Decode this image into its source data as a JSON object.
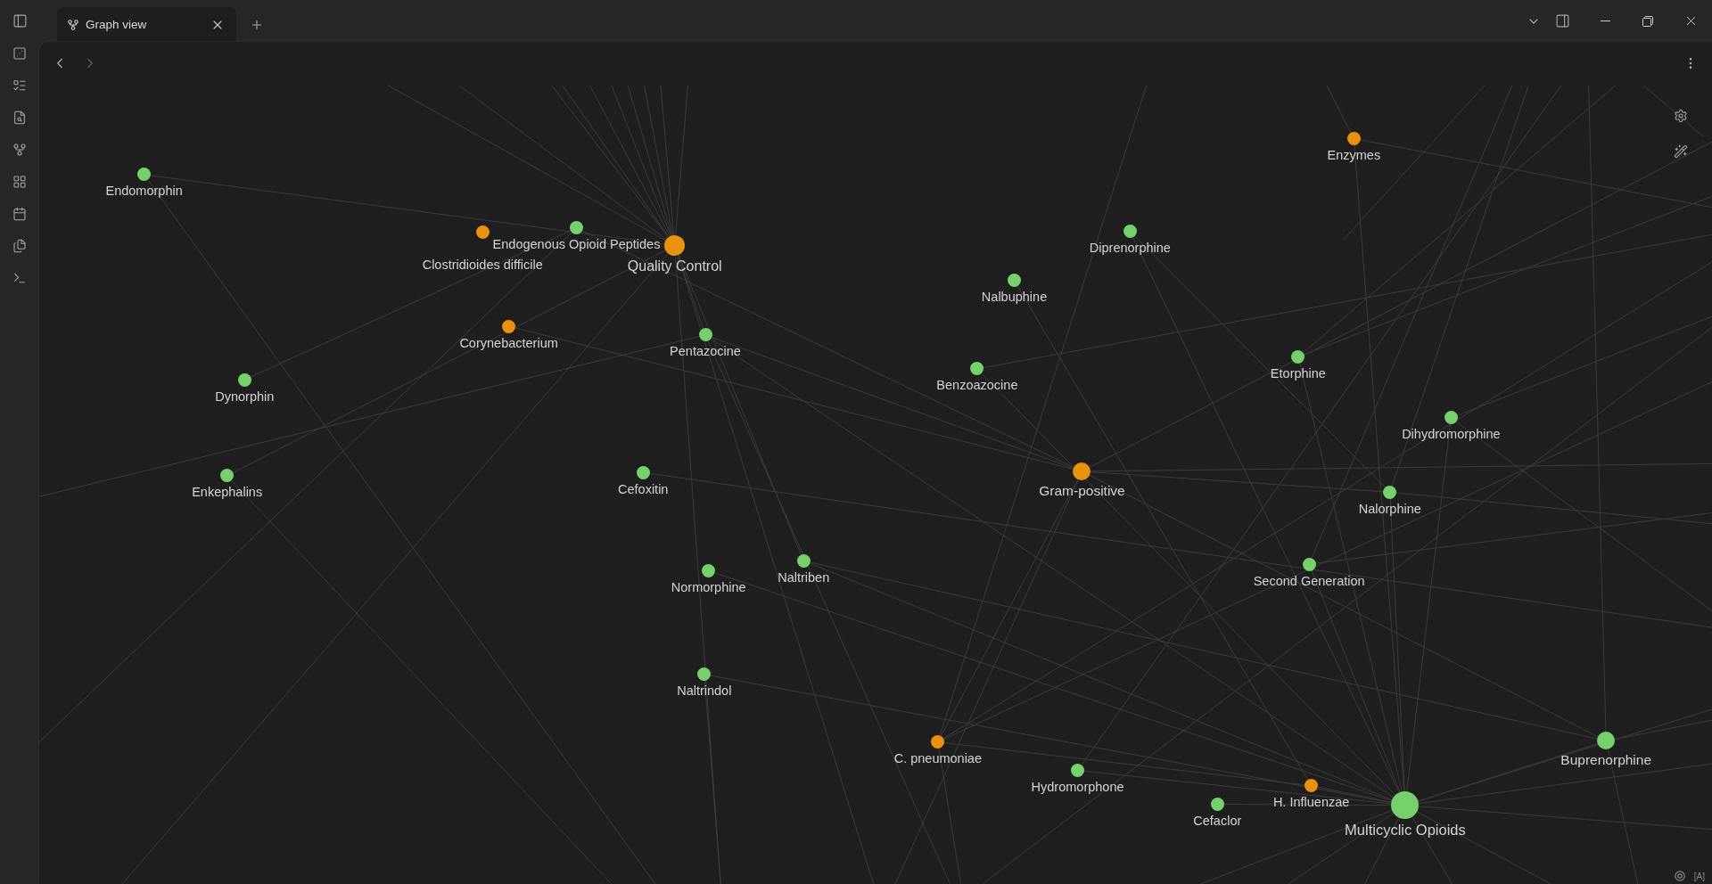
{
  "tabs": [
    {
      "label": "Graph view",
      "selected": true
    }
  ],
  "navigation": {
    "back_disabled": false,
    "forward_disabled": true
  },
  "graph": {
    "nodes": [
      {
        "label": "Endomorphin",
        "color": "#76d16c"
      },
      {
        "label": "Enzymes",
        "color": "#e8920f"
      },
      {
        "label": "Clostridioides difficile",
        "color": "#e8920f"
      },
      {
        "label": "Endogenous Opioid Peptides",
        "color": "#76d16c"
      },
      {
        "label": "Quality Control",
        "color": "#e8920f"
      },
      {
        "label": "Diprenorphine",
        "color": "#76d16c"
      },
      {
        "label": "Nalbuphine",
        "color": "#76d16c"
      },
      {
        "label": "Corynebacterium",
        "color": "#e8920f"
      },
      {
        "label": "Pentazocine",
        "color": "#76d16c"
      },
      {
        "label": "Etorphine",
        "color": "#76d16c"
      },
      {
        "label": "Dynorphin",
        "color": "#76d16c"
      },
      {
        "label": "Benzoazocine",
        "color": "#76d16c"
      },
      {
        "label": "Dihydromorphine",
        "color": "#76d16c"
      },
      {
        "label": "Enkephalins",
        "color": "#76d16c"
      },
      {
        "label": "Cefoxitin",
        "color": "#76d16c"
      },
      {
        "label": "Gram-positive",
        "color": "#e8920f"
      },
      {
        "label": "Nalorphine",
        "color": "#76d16c"
      },
      {
        "label": "Normorphine",
        "color": "#76d16c"
      },
      {
        "label": "Naltriben",
        "color": "#76d16c"
      },
      {
        "label": "Second Generation",
        "color": "#76d16c"
      },
      {
        "label": "Naltrindol",
        "color": "#76d16c"
      },
      {
        "label": "C. pneumoniae",
        "color": "#e8920f"
      },
      {
        "label": "Buprenorphine",
        "color": "#76d16c"
      },
      {
        "label": "Hydromorphone",
        "color": "#76d16c"
      },
      {
        "label": "H. Influenzae",
        "color": "#e8920f"
      },
      {
        "label": "Cefaclor",
        "color": "#76d16c"
      },
      {
        "label": "Multicyclic Opioids",
        "color": "#76d16c"
      }
    ]
  },
  "status_bar": {
    "indicator": "[A]"
  }
}
